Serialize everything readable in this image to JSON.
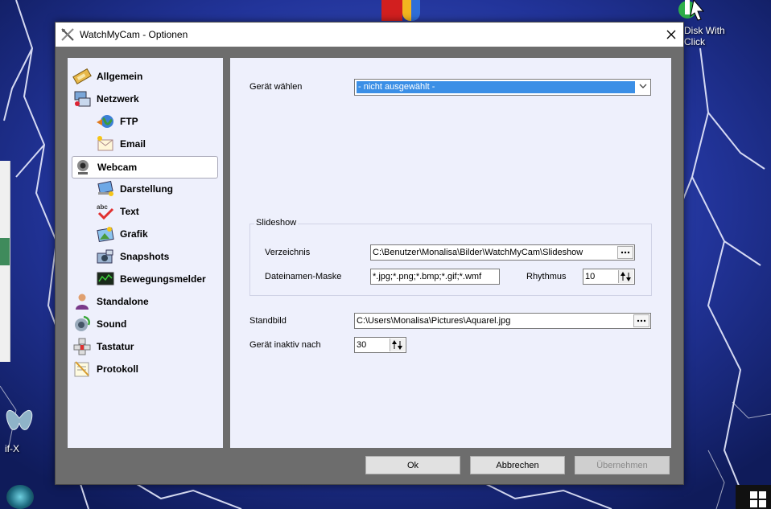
{
  "desktop": {
    "icons": [
      {
        "name": "disk-with-click",
        "label_line1": "Disk With",
        "label_line2": "Click"
      },
      {
        "name": "gif-x",
        "label": "if-X"
      }
    ]
  },
  "dialog": {
    "title": "WatchMyCam - Optionen",
    "sidebar": {
      "items": [
        {
          "label": "Allgemein",
          "icon": "film-strip-icon",
          "level": 0
        },
        {
          "label": "Netzwerk",
          "icon": "network-icon",
          "level": 0
        },
        {
          "label": "FTP",
          "icon": "globe-icon",
          "level": 1
        },
        {
          "label": "Email",
          "icon": "envelope-icon",
          "level": 1
        },
        {
          "label": "Webcam",
          "icon": "webcam-icon",
          "level": 0,
          "selected": true
        },
        {
          "label": "Darstellung",
          "icon": "display-icon",
          "level": 1
        },
        {
          "label": "Text",
          "icon": "abc-check-icon",
          "level": 1
        },
        {
          "label": "Grafik",
          "icon": "image-icon",
          "level": 1
        },
        {
          "label": "Snapshots",
          "icon": "camera-icon",
          "level": 1
        },
        {
          "label": "Bewegungsmelder",
          "icon": "motion-monitor-icon",
          "level": 1
        },
        {
          "label": "Standalone",
          "icon": "user-icon",
          "level": 0
        },
        {
          "label": "Sound",
          "icon": "speaker-icon",
          "level": 0
        },
        {
          "label": "Tastatur",
          "icon": "keyboard-icon",
          "level": 0
        },
        {
          "label": "Protokoll",
          "icon": "notepad-icon",
          "level": 0
        }
      ]
    },
    "content": {
      "device_label": "Gerät wählen",
      "device_value": "- nicht ausgewählt -",
      "slideshow": {
        "title": "Slideshow",
        "directory_label": "Verzeichnis",
        "directory_value": "C:\\Benutzer\\Monalisa\\Bilder\\WatchMyCam\\Slideshow",
        "filemask_label": "Dateinamen-Maske",
        "filemask_value": "*.jpg;*.png;*.bmp;*.gif;*.wmf",
        "rhythm_label": "Rhythmus",
        "rhythm_value": "10"
      },
      "still_image_label": "Standbild",
      "still_image_value": "C:\\Users\\Monalisa\\Pictures\\Aquarel.jpg",
      "inactive_label": "Gerät inaktiv nach",
      "inactive_value": "30"
    },
    "buttons": {
      "ok": "Ok",
      "cancel": "Abbrechen",
      "apply": "Übernehmen"
    }
  },
  "colors": {
    "accent_selection": "#3b8fe6",
    "panel_background": "#eef0fc",
    "dialog_frame": "#6d6d6d"
  }
}
